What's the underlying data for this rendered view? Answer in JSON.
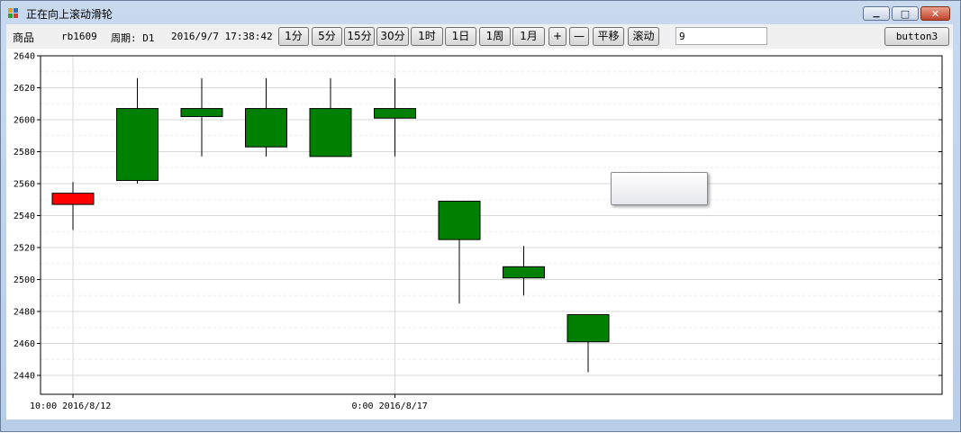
{
  "window": {
    "title": "正在向上滚动滑轮",
    "minimize_glyph": "▁",
    "maximize_glyph": "□",
    "close_glyph": "✕"
  },
  "toolbar": {
    "product_label": "商品",
    "product_value": "rb1609",
    "period_label": "周期: D1",
    "datetime": "2016/9/7 17:38:42",
    "buttons": [
      "1分",
      "5分",
      "15分",
      "30分",
      "1时",
      "1日",
      "1周",
      "1月",
      "+",
      "—",
      "平移",
      "滚动"
    ],
    "input_value": "9",
    "button3_label": "button3"
  },
  "colors": {
    "up": "#008000",
    "down": "#ff0000",
    "grid": "#d8d8d8",
    "axis": "#000000"
  },
  "chart_data": {
    "type": "candlestick",
    "ylim": [
      2430,
      2640
    ],
    "yticks": [
      2640,
      2620,
      2600,
      2580,
      2560,
      2540,
      2520,
      2500,
      2480,
      2460,
      2440
    ],
    "xlabels": [
      "10:00 2016/8/12",
      "0:00 2016/8/17"
    ],
    "candles": [
      {
        "open": 2547,
        "close": 2554,
        "high": 2561,
        "low": 2531,
        "color": "red"
      },
      {
        "open": 2607,
        "close": 2562,
        "high": 2626,
        "low": 2560,
        "color": "green"
      },
      {
        "open": 2607,
        "close": 2602,
        "high": 2626,
        "low": 2577,
        "color": "green"
      },
      {
        "open": 2607,
        "close": 2583,
        "high": 2626,
        "low": 2577,
        "color": "green"
      },
      {
        "open": 2607,
        "close": 2577,
        "high": 2626,
        "low": 2577,
        "color": "green"
      },
      {
        "open": 2607,
        "close": 2601,
        "high": 2626,
        "low": 2577,
        "color": "green"
      },
      {
        "open": 2549,
        "close": 2525,
        "high": 2549,
        "low": 2485,
        "color": "green"
      },
      {
        "open": 2508,
        "close": 2501,
        "high": 2521,
        "low": 2490,
        "color": "green"
      },
      {
        "open": 2478,
        "close": 2461,
        "high": 2478,
        "low": 2442,
        "color": "green"
      }
    ]
  }
}
